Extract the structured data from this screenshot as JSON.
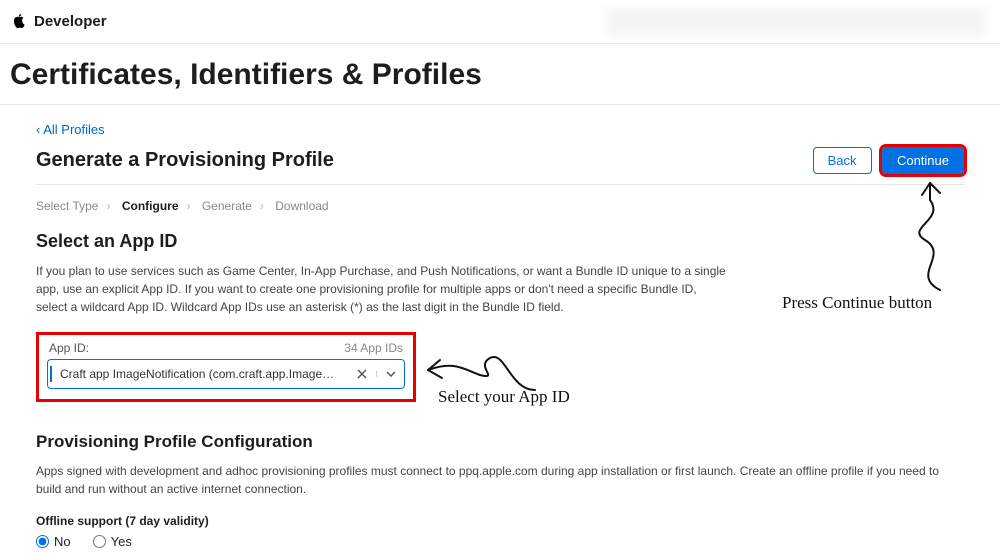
{
  "topbar": {
    "brand": "Developer"
  },
  "page_title": "Certificates, Identifiers & Profiles",
  "back_link": "‹  All Profiles",
  "generate": {
    "title": "Generate a Provisioning Profile",
    "back_btn": "Back",
    "continue_btn": "Continue"
  },
  "steps": {
    "s1": "Select Type",
    "s2": "Configure",
    "s3": "Generate",
    "s4": "Download"
  },
  "appid": {
    "heading": "Select an App ID",
    "desc": "If you plan to use services such as Game Center, In-App Purchase, and Push Notifications, or want a Bundle ID unique to a single app, use an explicit App ID. If you want to create one provisioning profile for multiple apps or don't need a specific Bundle ID, select a wildcard App ID. Wildcard App IDs use an asterisk (*) as the last digit in the Bundle ID field.",
    "label": "App ID:",
    "count": "34 App IDs",
    "value": "Craft app ImageNotification (com.craft.app.ImageNotificati…"
  },
  "ppc": {
    "heading": "Provisioning Profile Configuration",
    "desc": "Apps signed with development and adhoc provisioning profiles must connect to ppq.apple.com during app installation or first launch. Create an offline profile if you need to build and run without an active internet connection.",
    "offline_label": "Offline support (7 day validity)",
    "no": "No",
    "yes": "Yes"
  },
  "annotations": {
    "continue": "Press Continue button",
    "appid": "Select your App ID"
  }
}
